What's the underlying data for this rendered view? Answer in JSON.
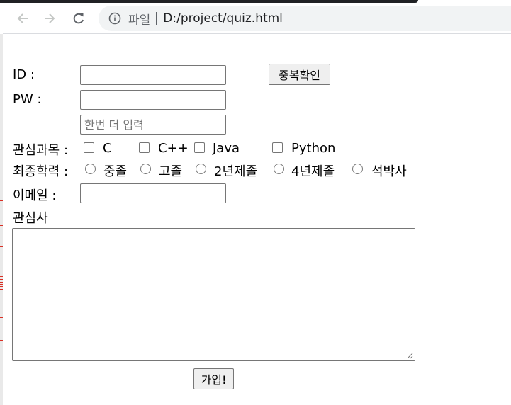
{
  "browser": {
    "omnibox_scheme": "파일",
    "url": "D:/project/quiz.html"
  },
  "form": {
    "id_label": "ID :",
    "pw_label": "PW :",
    "pw_confirm_placeholder": "한번 더 입력",
    "dup_check_button": "중복확인",
    "subjects_label": "관심과목 :",
    "subjects": [
      "C",
      "C++",
      "Java",
      "Python"
    ],
    "education_label": "최종학력 :",
    "education": [
      "중졸",
      "고졸",
      "2년제졸",
      "4년제졸",
      "석박사"
    ],
    "email_label": "이메일 :",
    "interests_label": "관심사",
    "submit_button": "가입!"
  }
}
